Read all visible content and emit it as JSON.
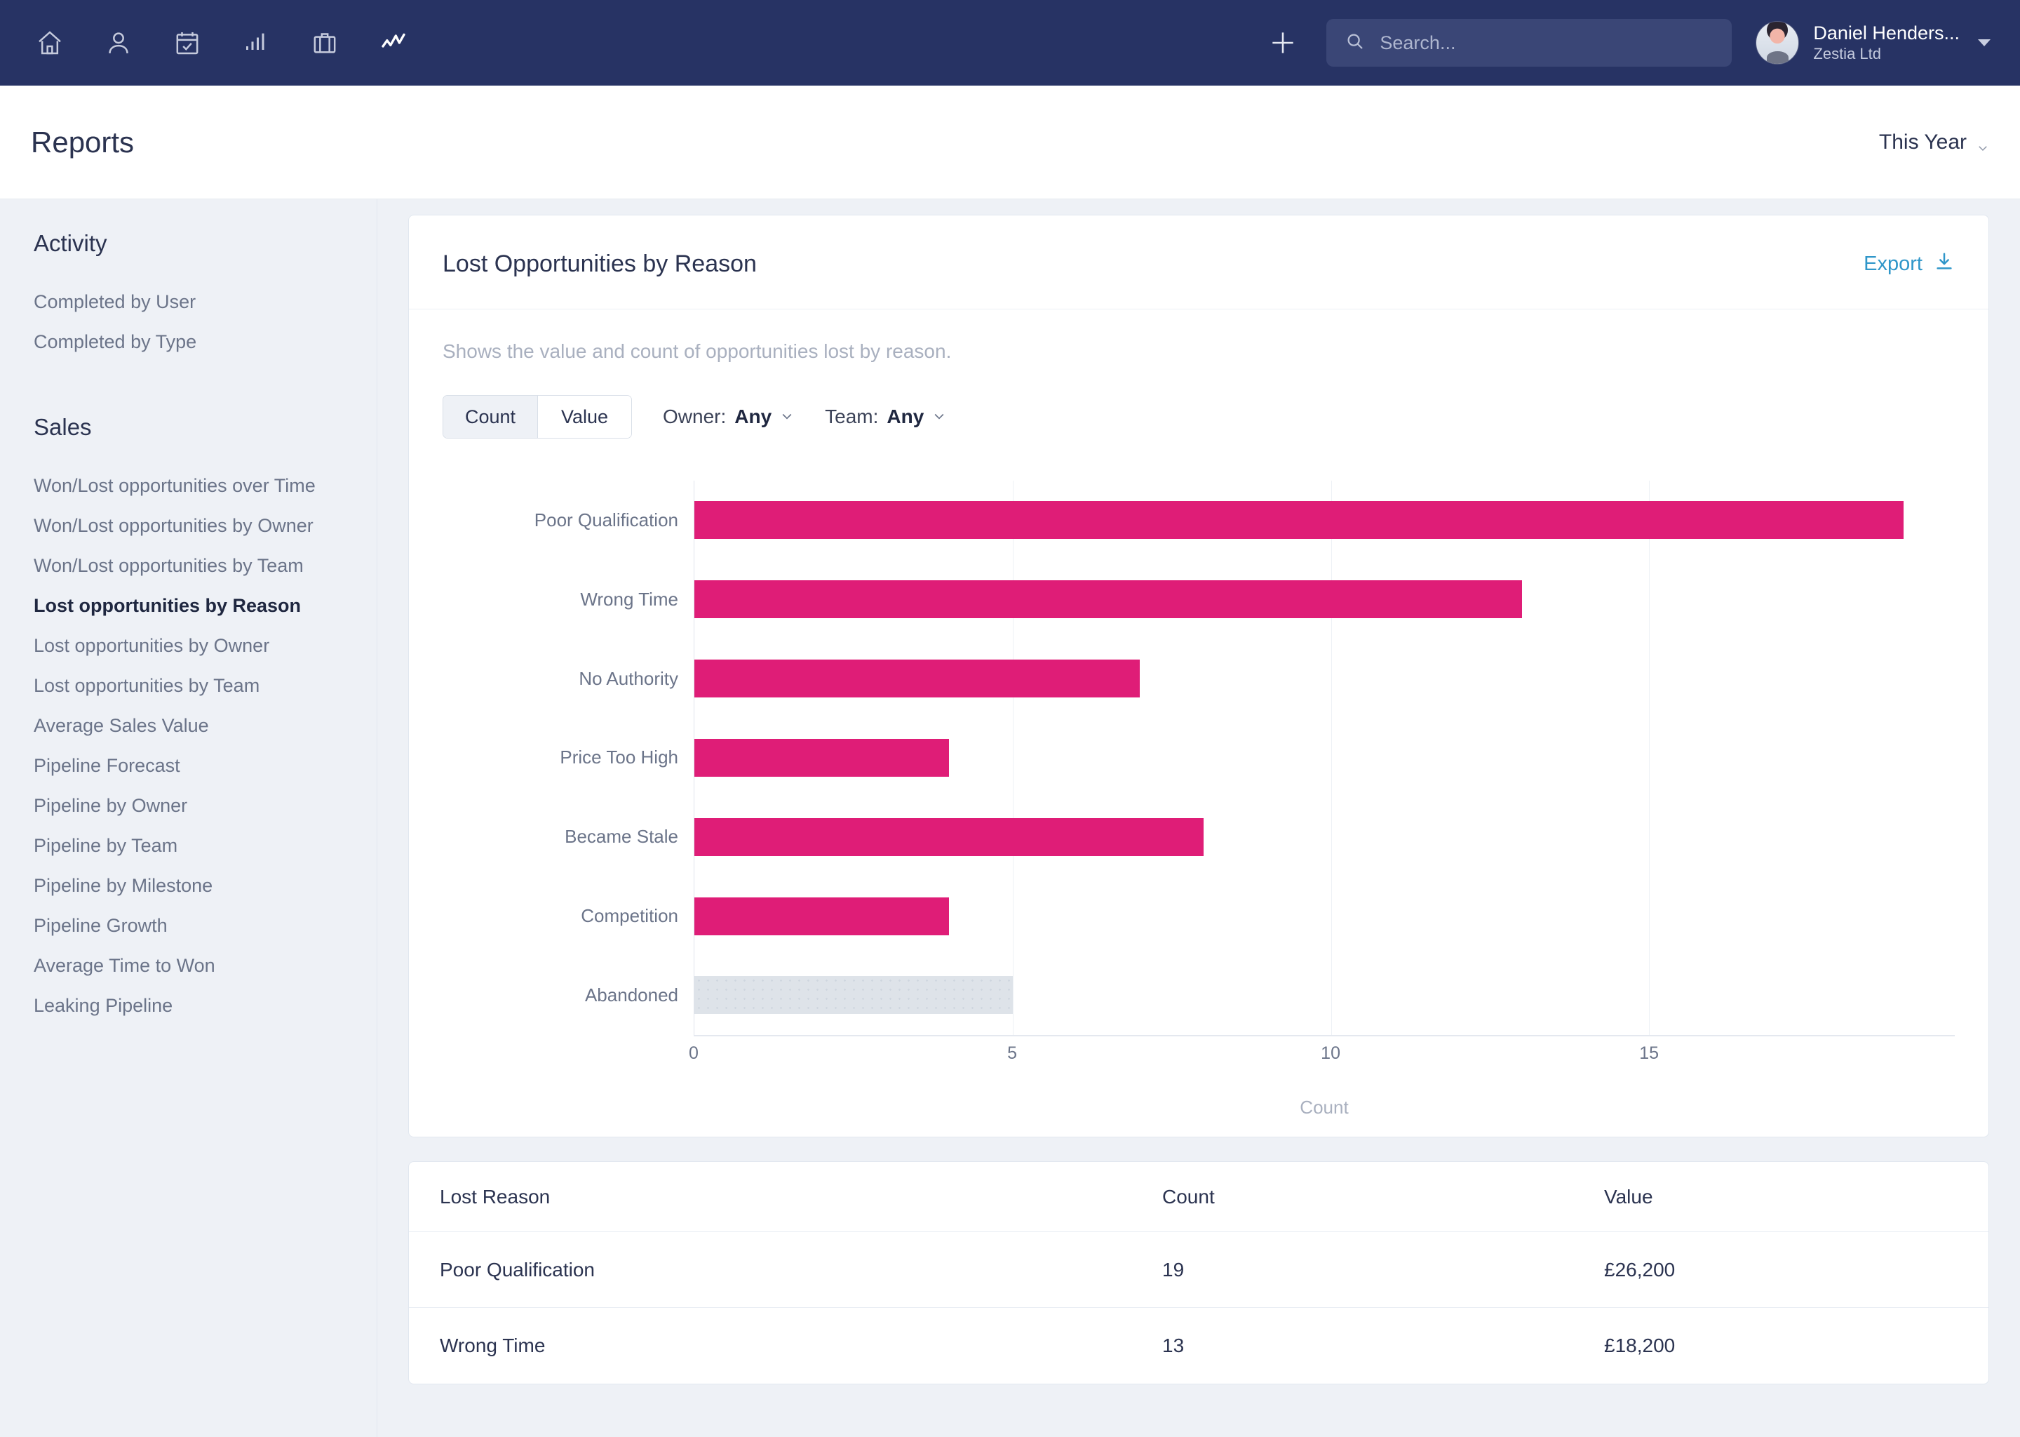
{
  "topnav": {
    "icons": [
      {
        "name": "home-icon",
        "label": "Home"
      },
      {
        "name": "person-icon",
        "label": "Contacts"
      },
      {
        "name": "calendar-check-icon",
        "label": "Activities"
      },
      {
        "name": "bar-chart-icon",
        "label": "Pipeline"
      },
      {
        "name": "briefcase-icon",
        "label": "Opportunities"
      },
      {
        "name": "trend-line-icon",
        "label": "Reports"
      }
    ],
    "add_label": "+",
    "search_placeholder": "Search...",
    "search_value": "",
    "user_name": "Daniel Henders...",
    "user_org": "Zestia Ltd"
  },
  "header": {
    "title": "Reports",
    "period_label": "This Year"
  },
  "sidebar": {
    "groups": [
      {
        "heading": "Activity",
        "items": [
          {
            "label": "Completed by User",
            "active": false
          },
          {
            "label": "Completed by Type",
            "active": false
          }
        ]
      },
      {
        "heading": "Sales",
        "items": [
          {
            "label": "Won/Lost opportunities over Time",
            "active": false
          },
          {
            "label": "Won/Lost opportunities by Owner",
            "active": false
          },
          {
            "label": "Won/Lost opportunities by Team",
            "active": false
          },
          {
            "label": "Lost opportunities by Reason",
            "active": true
          },
          {
            "label": "Lost opportunities by Owner",
            "active": false
          },
          {
            "label": "Lost opportunities by Team",
            "active": false
          },
          {
            "label": "Average Sales Value",
            "active": false
          },
          {
            "label": "Pipeline Forecast",
            "active": false
          },
          {
            "label": "Pipeline by Owner",
            "active": false
          },
          {
            "label": "Pipeline by Team",
            "active": false
          },
          {
            "label": "Pipeline by Milestone",
            "active": false
          },
          {
            "label": "Pipeline Growth",
            "active": false
          },
          {
            "label": "Average Time to Won",
            "active": false
          },
          {
            "label": "Leaking Pipeline",
            "active": false
          }
        ]
      }
    ]
  },
  "report": {
    "title": "Lost Opportunities by Reason",
    "export_label": "Export",
    "description": "Shows the value and count of opportunities lost by reason.",
    "toggle": {
      "options": [
        "Count",
        "Value"
      ],
      "selected": "Count"
    },
    "filters": [
      {
        "label": "Owner:",
        "value": "Any"
      },
      {
        "label": "Team:",
        "value": "Any"
      }
    ]
  },
  "chart_data": {
    "type": "bar",
    "orientation": "horizontal",
    "title": "Lost Opportunities by Reason",
    "xlabel": "Count",
    "ylabel": "",
    "xlim": [
      0,
      19.8
    ],
    "xticks": [
      0,
      5,
      10,
      15
    ],
    "grid": true,
    "legend": "none",
    "categories": [
      "Poor Qualification",
      "Wrong Time",
      "No Authority",
      "Price Too High",
      "Became Stale",
      "Competition",
      "Abandoned"
    ],
    "values": [
      19,
      13,
      7,
      4,
      8,
      4,
      5
    ],
    "bar_colors": [
      "#df1d77",
      "#df1d77",
      "#df1d77",
      "#df1d77",
      "#df1d77",
      "#df1d77",
      "#dee3e9"
    ],
    "accent_color": "#df1d77",
    "muted_color": "#dee3e9"
  },
  "table": {
    "columns": [
      "Lost Reason",
      "Count",
      "Value"
    ],
    "rows": [
      {
        "reason": "Poor Qualification",
        "count": "19",
        "value": "£26,200"
      },
      {
        "reason": "Wrong Time",
        "count": "13",
        "value": "£18,200"
      }
    ]
  }
}
